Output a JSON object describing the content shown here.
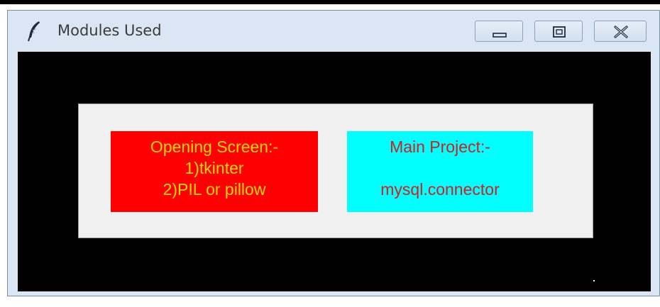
{
  "window": {
    "title": "Modules Used",
    "app_icon": "feather-icon",
    "controls": {
      "minimize_icon": "minimize-icon",
      "maximize_icon": "maximize-icon",
      "close_icon": "close-icon"
    }
  },
  "content": {
    "opening_label": {
      "lines": [
        "Opening Screen:-",
        "1)tkinter",
        "2)PIL or pillow"
      ],
      "background": "#ff0000",
      "foreground": "#ffd800"
    },
    "main_label": {
      "lines": [
        "Main Project:-",
        "",
        "mysql.connector"
      ],
      "background": "#00ffff",
      "foreground": "#cc2222"
    }
  },
  "colors": {
    "client_background": "#000000",
    "panel_background": "#f0f0f0",
    "titlebar": "#dbe6f4"
  }
}
